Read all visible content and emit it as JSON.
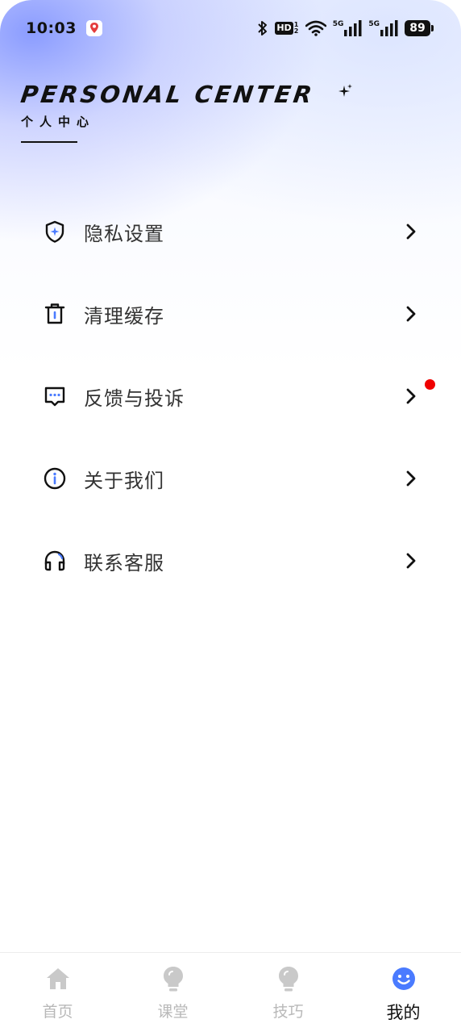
{
  "status_bar": {
    "time": "10:03",
    "hd": "HD",
    "hd_sub": "1 2",
    "signal1": "5G",
    "signal2": "5G",
    "battery": "89"
  },
  "header": {
    "title": "PERSONAL CENTER",
    "subtitle": "个人中心"
  },
  "menu": [
    {
      "label": "隐私设置",
      "icon": "shield-icon"
    },
    {
      "label": "清理缓存",
      "icon": "trash-icon"
    },
    {
      "label": "反馈与投诉",
      "icon": "message-icon",
      "has_badge": true
    },
    {
      "label": "关于我们",
      "icon": "info-icon"
    },
    {
      "label": "联系客服",
      "icon": "headset-icon"
    }
  ],
  "tabbar": {
    "tabs": [
      {
        "label": "首页",
        "icon": "home-icon",
        "active": false
      },
      {
        "label": "课堂",
        "icon": "bulb-icon",
        "active": false
      },
      {
        "label": "技巧",
        "icon": "bulb-icon",
        "active": false
      },
      {
        "label": "我的",
        "icon": "smile-icon",
        "active": true
      }
    ]
  },
  "colors": {
    "accent": "#4a7bff",
    "badge": "#f00000",
    "inactive_tab": "#b8b8b8"
  }
}
